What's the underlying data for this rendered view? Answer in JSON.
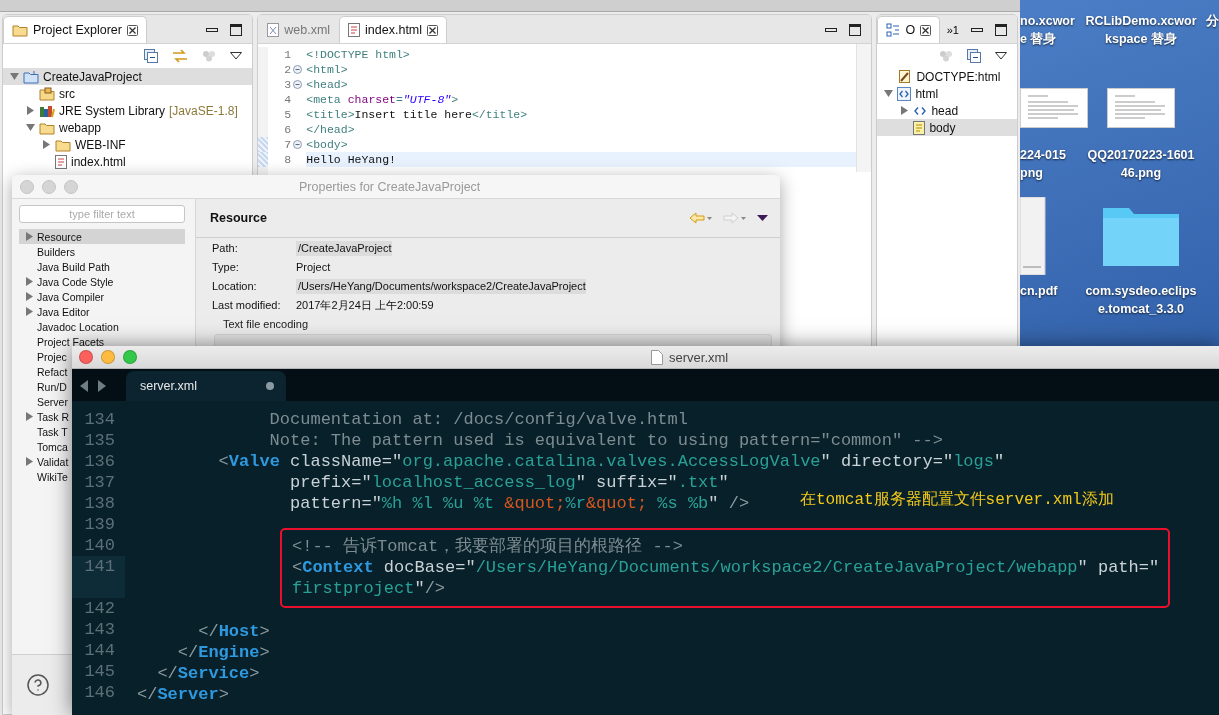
{
  "eclipse": {
    "project_explorer": {
      "title": "Project Explorer",
      "tree": [
        {
          "label": "CreateJavaProject",
          "kind": "project",
          "expanded": true,
          "selected": true,
          "children": [
            {
              "label": "src",
              "kind": "source-folder",
              "selected": false
            },
            {
              "label": "JRE System Library",
              "decoration": "[JavaSE-1.8]",
              "kind": "library",
              "expanded": false,
              "selected": false
            },
            {
              "label": "webapp",
              "kind": "folder",
              "expanded": true,
              "selected": false,
              "children": [
                {
                  "label": "WEB-INF",
                  "kind": "folder",
                  "expanded": false,
                  "selected": false
                },
                {
                  "label": "index.html",
                  "kind": "file",
                  "selected": false
                }
              ]
            }
          ]
        }
      ]
    },
    "editor": {
      "tabs": [
        {
          "label": "web.xml",
          "kind": "xml",
          "selected": false
        },
        {
          "label": "index.html",
          "kind": "html",
          "selected": true
        }
      ],
      "lines": [
        {
          "number": "1",
          "fold": false,
          "changed": false,
          "current": false,
          "tokens": [
            {
              "kind": "tag",
              "text": "<!DOCTYPE html>"
            }
          ]
        },
        {
          "number": "2",
          "fold": true,
          "changed": false,
          "current": false,
          "tokens": [
            {
              "kind": "tag",
              "text": "<html>"
            }
          ]
        },
        {
          "number": "3",
          "fold": true,
          "changed": false,
          "current": false,
          "tokens": [
            {
              "kind": "tag",
              "text": "<head>"
            }
          ]
        },
        {
          "number": "4",
          "fold": false,
          "changed": false,
          "current": false,
          "tokens": [
            {
              "kind": "tag",
              "text": "<meta "
            },
            {
              "kind": "attr",
              "text": "charset"
            },
            {
              "kind": "tag",
              "text": "="
            },
            {
              "kind": "value",
              "text": "\"UTF-8\""
            },
            {
              "kind": "tag",
              "text": ">"
            }
          ]
        },
        {
          "number": "5",
          "fold": false,
          "changed": false,
          "current": false,
          "tokens": [
            {
              "kind": "tag",
              "text": "<title>"
            },
            {
              "kind": "text",
              "text": "Insert title here"
            },
            {
              "kind": "tag",
              "text": "</title>"
            }
          ]
        },
        {
          "number": "6",
          "fold": false,
          "changed": false,
          "current": false,
          "tokens": [
            {
              "kind": "tag",
              "text": "</head>"
            }
          ]
        },
        {
          "number": "7",
          "fold": true,
          "changed": true,
          "current": false,
          "tokens": [
            {
              "kind": "tag",
              "text": "<body>"
            }
          ]
        },
        {
          "number": "8",
          "fold": false,
          "changed": true,
          "current": true,
          "tokens": [
            {
              "kind": "text",
              "text": "Hello HeYang!"
            }
          ]
        }
      ]
    },
    "outline": {
      "title": "O",
      "overflow": "»1",
      "tree": [
        {
          "label": "DOCTYPE:html",
          "kind": "doctype",
          "selected": false
        },
        {
          "label": "html",
          "kind": "element-box",
          "expanded": true,
          "selected": false,
          "children": [
            {
              "label": "head",
              "kind": "element",
              "expanded": false,
              "selected": false
            },
            {
              "label": "body",
              "kind": "element-page",
              "selected": true
            }
          ]
        }
      ]
    }
  },
  "properties_dialog": {
    "title": "Properties for CreateJavaProject",
    "filter": {
      "placeholder": "type filter text"
    },
    "pages": [
      {
        "label": "Resource",
        "expandable": true,
        "selected": true
      },
      {
        "label": "Builders",
        "expandable": false,
        "selected": false
      },
      {
        "label": "Java Build Path",
        "expandable": false,
        "selected": false
      },
      {
        "label": "Java Code Style",
        "expandable": true,
        "selected": false
      },
      {
        "label": "Java Compiler",
        "expandable": true,
        "selected": false
      },
      {
        "label": "Java Editor",
        "expandable": true,
        "selected": false
      },
      {
        "label": "Javadoc Location",
        "expandable": false,
        "selected": false
      },
      {
        "label": "Project Facets",
        "expandable": false,
        "selected": false
      },
      {
        "label": "Projec",
        "expandable": false,
        "selected": false
      },
      {
        "label": "Refact",
        "expandable": false,
        "selected": false
      },
      {
        "label": "Run/D",
        "expandable": false,
        "selected": false
      },
      {
        "label": "Server",
        "expandable": false,
        "selected": false
      },
      {
        "label": "Task R",
        "expandable": true,
        "selected": false
      },
      {
        "label": "Task T",
        "expandable": false,
        "selected": false
      },
      {
        "label": "Tomca",
        "expandable": false,
        "selected": false
      },
      {
        "label": "Validat",
        "expandable": true,
        "selected": false
      },
      {
        "label": "WikiTe",
        "expandable": false,
        "selected": false
      }
    ],
    "heading": "Resource",
    "fields": [
      {
        "label": "Path:",
        "value": "/CreateJavaProject",
        "kind": "field"
      },
      {
        "label": "Type:",
        "value": "Project",
        "kind": "text"
      },
      {
        "label": "Location:",
        "value": "/Users/HeYang/Documents/workspace2/CreateJavaProject",
        "kind": "field"
      },
      {
        "label": "Last modified:",
        "value": "2017年2月24日 上午2:00:59",
        "kind": "text"
      }
    ],
    "group": "Text file encoding"
  },
  "sublime": {
    "title": "server.xml",
    "tab": {
      "label": "server.xml",
      "dirty": true
    },
    "note": "在tomcat服务器配置文件server.xml添加",
    "lines": [
      {
        "number": "134",
        "current": false,
        "boxed": false,
        "tokens": [
          {
            "kind": "comment",
            "text": "             Documentation at: /docs/config/valve.html"
          }
        ]
      },
      {
        "number": "135",
        "current": false,
        "boxed": false,
        "tokens": [
          {
            "kind": "comment",
            "text": "             Note: The pattern used is equivalent to using pattern=\"common\" -->"
          }
        ]
      },
      {
        "number": "136",
        "current": false,
        "boxed": false,
        "tokens": [
          {
            "kind": "punct",
            "text": "        <"
          },
          {
            "kind": "tag",
            "text": "Valve"
          },
          {
            "kind": "attr",
            "text": " className=\""
          },
          {
            "kind": "string",
            "text": "org.apache.catalina.valves.AccessLogValve"
          },
          {
            "kind": "attr",
            "text": "\" directory=\""
          },
          {
            "kind": "string",
            "text": "logs"
          },
          {
            "kind": "attr",
            "text": "\""
          }
        ]
      },
      {
        "number": "137",
        "current": false,
        "boxed": false,
        "tokens": [
          {
            "kind": "attr",
            "text": "               prefix=\""
          },
          {
            "kind": "string",
            "text": "localhost_access_log"
          },
          {
            "kind": "attr",
            "text": "\" suffix=\""
          },
          {
            "kind": "string",
            "text": ".txt"
          },
          {
            "kind": "attr",
            "text": "\""
          }
        ]
      },
      {
        "number": "138",
        "current": false,
        "boxed": false,
        "tokens": [
          {
            "kind": "attr",
            "text": "               pattern=\""
          },
          {
            "kind": "string",
            "text": "%h %l %u %t "
          },
          {
            "kind": "entity",
            "text": "&quot;"
          },
          {
            "kind": "string",
            "text": "%r"
          },
          {
            "kind": "entity",
            "text": "&quot;"
          },
          {
            "kind": "string",
            "text": " %s %b"
          },
          {
            "kind": "attr",
            "text": "\""
          },
          {
            "kind": "punct",
            "text": " />"
          }
        ]
      },
      {
        "number": "139",
        "current": false,
        "boxed": false
      },
      {
        "number": "140",
        "current": false,
        "boxed": true,
        "tokens": [
          {
            "kind": "comment",
            "text": "<!-- 告诉Tomcat，我要部署的项目的根路径 -->"
          }
        ]
      },
      {
        "number": "141",
        "current": true,
        "boxed": true,
        "tokens": [
          {
            "kind": "punct",
            "text": "<"
          },
          {
            "kind": "tag",
            "text": "Context"
          },
          {
            "kind": "attr",
            "text": " docBase=\""
          },
          {
            "kind": "string",
            "text": "/Users/HeYang/Documents/workspace2/CreateJavaProject/webapp"
          },
          {
            "kind": "attr",
            "text": "\" path=\""
          }
        ]
      },
      {
        "current": true,
        "boxed": true,
        "tokens": [
          {
            "kind": "string",
            "text": "firstproject"
          },
          {
            "kind": "attr",
            "text": "\""
          },
          {
            "kind": "punct",
            "text": "/>"
          }
        ]
      },
      {
        "number": "142",
        "current": false,
        "boxed": false
      },
      {
        "number": "143",
        "current": false,
        "boxed": false,
        "tokens": [
          {
            "kind": "punct",
            "text": "      </"
          },
          {
            "kind": "tag",
            "text": "Host"
          },
          {
            "kind": "punct",
            "text": ">"
          }
        ]
      },
      {
        "number": "144",
        "current": false,
        "boxed": false,
        "tokens": [
          {
            "kind": "punct",
            "text": "    </"
          },
          {
            "kind": "tag",
            "text": "Engine"
          },
          {
            "kind": "punct",
            "text": ">"
          }
        ]
      },
      {
        "number": "145",
        "current": false,
        "boxed": false,
        "tokens": [
          {
            "kind": "punct",
            "text": "  </"
          },
          {
            "kind": "tag",
            "text": "Service"
          },
          {
            "kind": "punct",
            "text": ">"
          }
        ]
      },
      {
        "number": "146",
        "current": false,
        "boxed": false,
        "tokens": [
          {
            "kind": "punct",
            "text": "</"
          },
          {
            "kind": "tag",
            "text": "Server"
          },
          {
            "kind": "punct",
            "text": ">"
          }
        ]
      }
    ]
  },
  "desktop": {
    "icons": [
      {
        "kind": "none",
        "lines": [
          "no.xcwor",
          "e 替身"
        ]
      },
      {
        "kind": "none",
        "lines": [
          "RCLibDemo.xcwor",
          "kspace 替身"
        ]
      },
      {
        "kind": "none",
        "lines": [
          "分"
        ]
      },
      {
        "kind": "screenshot",
        "lines": [
          "224-015",
          "png"
        ]
      },
      {
        "kind": "screenshot",
        "lines": [
          "QQ20170223-1601",
          "46.png"
        ]
      },
      {
        "kind": "document",
        "lines": [
          "cn.pdf"
        ]
      },
      {
        "kind": "folder",
        "lines": [
          "com.sysdeo.eclips",
          "e.tomcat_3.3.0"
        ]
      }
    ]
  }
}
